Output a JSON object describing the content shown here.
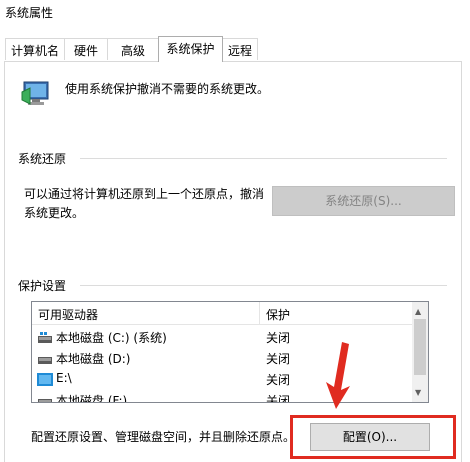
{
  "window": {
    "title": "系统属性"
  },
  "tabs": [
    {
      "label": "计算机名",
      "active": false
    },
    {
      "label": "硬件",
      "active": false
    },
    {
      "label": "高级",
      "active": false
    },
    {
      "label": "系统保护",
      "active": true
    },
    {
      "label": "远程",
      "active": false
    }
  ],
  "intro": {
    "text": "使用系统保护撤消不需要的系统更改。",
    "icon": "system-protection-shield-icon"
  },
  "system_restore": {
    "section_title": "系统还原",
    "description": "可以通过将计算机还原到上一个还原点，撤消系统更改。",
    "button_label": "系统还原(S)...",
    "button_enabled": false
  },
  "protection_settings": {
    "section_title": "保护设置",
    "columns": [
      "可用驱动器",
      "保护"
    ],
    "drives": [
      {
        "name": "本地磁盘 (C:) (系统)",
        "protection": "关闭",
        "icon": "system-drive-icon"
      },
      {
        "name": "本地磁盘 (D:)",
        "protection": "关闭",
        "icon": "drive-icon"
      },
      {
        "name": "E:\\",
        "protection": "关闭",
        "icon": "removable-drive-icon"
      },
      {
        "name": "本地磁盘 (F:)",
        "protection": "关闭",
        "icon": "drive-icon"
      }
    ]
  },
  "configure": {
    "description": "配置还原设置、管理磁盘空间，并且删除还原点。",
    "button_label": "配置(O)..."
  },
  "colors": {
    "highlight": "#e02b20",
    "disabled_button": "#cccccc",
    "accent": "#0078d7"
  }
}
